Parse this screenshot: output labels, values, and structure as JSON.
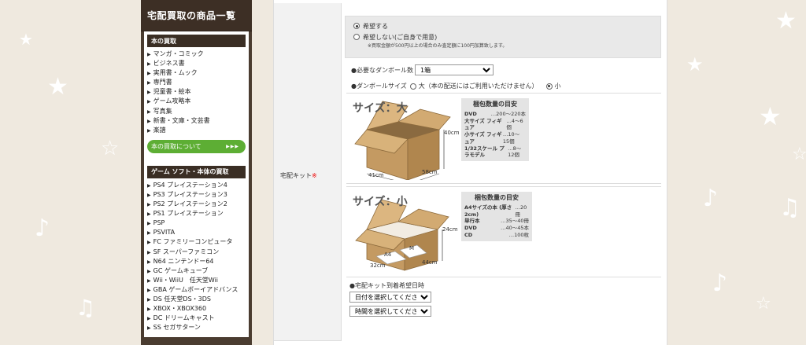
{
  "sidebar": {
    "title": "宅配買取の商品一覧",
    "book_section": {
      "heading": "本の買取",
      "items": [
        "マンガ・コミック",
        "ビジネス書",
        "実用書・ムック",
        "専門書",
        "児童書・絵本",
        "ゲーム攻略本",
        "写真集",
        "新書・文庫・文芸書",
        "楽譜"
      ],
      "button_label": "本の買取について",
      "button_arrows": "▶▶▶"
    },
    "game_section": {
      "heading": "ゲーム ソフト・本体の買取",
      "items": [
        "PS4 プレイステーション4",
        "PS3 プレイステーション3",
        "PS2 プレイステーション2",
        "PS1 プレイステーション",
        "PSP",
        "PSVITA",
        "FC ファミリーコンピュータ",
        "SF スーパーファミコン",
        "N64 ニンテンドー64",
        "GC ゲームキューブ",
        "Wii・WiiU　任天堂Wii",
        "GBA ゲームボーイアドバンス",
        "DS 任天堂DS・3DS",
        "XBOX・XBOX360",
        "DC ドリームキャスト",
        "SS セガサターン"
      ]
    }
  },
  "form": {
    "field_label": "宅配キット",
    "required_mark": "※",
    "kit_options": {
      "yes": "希望する",
      "no": "希望しない(ご自身で用意)",
      "note": "※買取金額が500円以上の場合のみ査定額に100円加算致します。"
    },
    "qty_label": "●必要なダンボール数",
    "qty_value": "1箱",
    "size_label": "●ダンボールサイズ",
    "size_large": "大（本の配送にはご利用いただけません）",
    "size_small": "小",
    "date_label": "●宅配キット到着希望日時",
    "date_select": "日付を選択してください",
    "time_select": "時間を選択してください"
  },
  "boxes": {
    "large": {
      "title": "サイズ：大",
      "dims": {
        "h": "40cm",
        "w": "41cm",
        "d": "58cm"
      },
      "guide_title": "梱包数量の目安",
      "guide": [
        {
          "name": "DVD",
          "value": "…200〜220本"
        },
        {
          "name": "大サイズ フィギュア",
          "value": "…4〜6個"
        },
        {
          "name": "小サイズ フィギュア",
          "value": "…10〜15個"
        },
        {
          "name": "1/32スケール プラモデル",
          "value": "…8〜12個"
        }
      ]
    },
    "small": {
      "title": "サイズ：小",
      "dims": {
        "h": "24cm",
        "w": "32cm",
        "d": "44cm"
      },
      "inner": [
        "A4",
        "M"
      ],
      "guide_title": "梱包数量の目安",
      "guide": [
        {
          "name": "A4サイズの本 (厚さ2cm)",
          "value": "…20冊"
        },
        {
          "name": "単行本",
          "value": "…35〜40冊"
        },
        {
          "name": "DVD",
          "value": "…40〜45本"
        },
        {
          "name": "CD",
          "value": "…100枚"
        }
      ]
    }
  },
  "colors": {
    "sidebar_bg": "#4a3c30",
    "accent_green": "#5dae34",
    "required_red": "#e00000",
    "box_brown": "#c9a06a"
  }
}
